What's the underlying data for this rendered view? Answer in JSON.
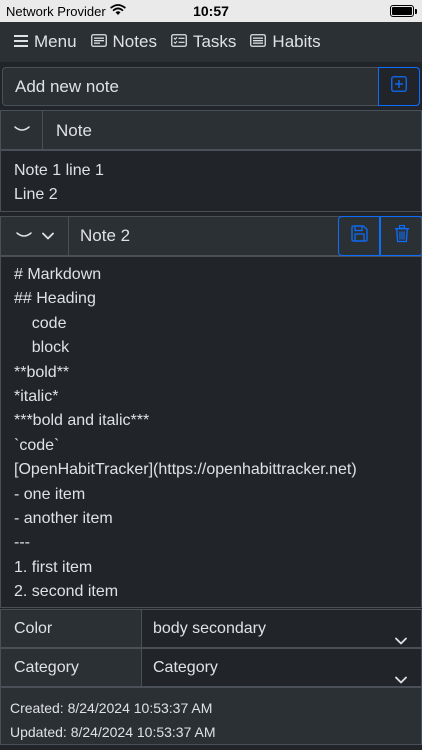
{
  "status_bar": {
    "carrier": "Network Provider",
    "time": "10:57"
  },
  "navbar": {
    "menu": "Menu",
    "notes": "Notes",
    "tasks": "Tasks",
    "habits": "Habits"
  },
  "add_note": {
    "placeholder": "Add new note"
  },
  "note1": {
    "title": "Note",
    "lines": [
      "Note 1 line 1",
      "Line 2"
    ]
  },
  "note2": {
    "title": "Note 2",
    "content": "# Markdown\n## Heading\n    code\n    block\n**bold**\n*italic*\n***bold and italic***\n`code`\n[OpenHabitTracker](https://openhabittracker.net)\n- one item\n- another item\n---\n1. first item\n2. second item",
    "color_label": "Color",
    "color_value": "body secondary",
    "category_label": "Category",
    "category_value": "Category",
    "created": "Created: 8/24/2024 10:53:37 AM",
    "updated": "Updated: 8/24/2024 10:53:37 AM"
  },
  "colors": {
    "background": "#212529",
    "surface": "#2b3035",
    "border": "#495057",
    "accent": "#0d6efd",
    "text": "#dee2e6"
  },
  "icons": {
    "menu": "hamburger-icon",
    "notes": "note-card-icon",
    "tasks": "checklist-icon",
    "habits": "list-card-icon",
    "add": "plus-square-icon",
    "collapse": "chevron-down-icon",
    "save": "floppy-disk-icon",
    "delete": "trash-icon"
  }
}
